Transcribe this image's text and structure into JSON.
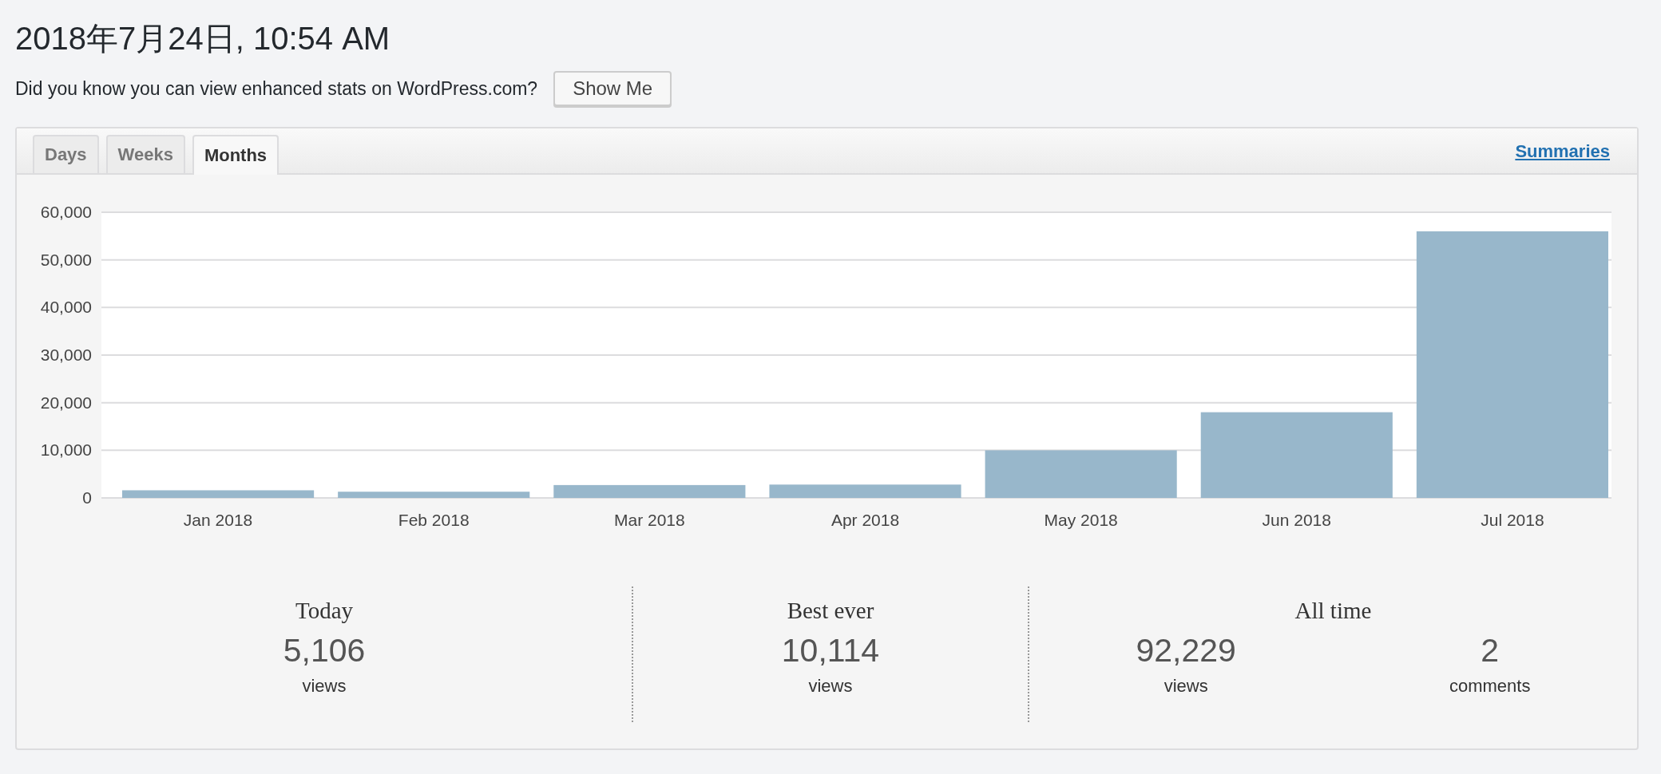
{
  "title": "2018年7月24日, 10:54 AM",
  "notice": {
    "text": "Did you know you can view enhanced stats on WordPress.com?",
    "button": "Show Me"
  },
  "tabs": [
    {
      "label": "Days",
      "selected": false
    },
    {
      "label": "Weeks",
      "selected": false
    },
    {
      "label": "Months",
      "selected": true
    }
  ],
  "summaries_link": "Summaries",
  "chart": {
    "chart_data": {
      "type": "bar",
      "categories": [
        "Jan 2018",
        "Feb 2018",
        "Mar 2018",
        "Apr 2018",
        "May 2018",
        "Jun 2018",
        "Jul 2018"
      ],
      "values": [
        1600,
        1300,
        2700,
        2800,
        10000,
        18000,
        56000
      ],
      "grid": true,
      "ylim": [
        0,
        60000
      ],
      "yticks": [
        {
          "value": 0,
          "label": "0"
        },
        {
          "value": 10000,
          "label": "10,000"
        },
        {
          "value": 20000,
          "label": "20,000"
        },
        {
          "value": 30000,
          "label": "30,000"
        },
        {
          "value": 40000,
          "label": "40,000"
        },
        {
          "value": 50000,
          "label": "50,000"
        },
        {
          "value": 60000,
          "label": "60,000"
        }
      ]
    }
  },
  "stats": [
    {
      "heading": "Today",
      "items": [
        {
          "value": "5,106",
          "label": "views"
        }
      ]
    },
    {
      "heading": "Best ever",
      "items": [
        {
          "value": "10,114",
          "label": "views"
        }
      ]
    },
    {
      "heading": "All time",
      "items": [
        {
          "value": "92,229",
          "label": "views"
        },
        {
          "value": "2",
          "label": "comments"
        }
      ]
    }
  ]
}
